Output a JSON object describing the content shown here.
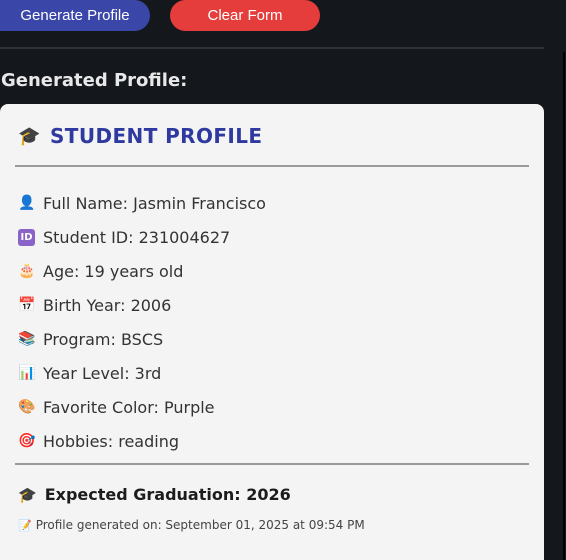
{
  "toolbar": {
    "generate_label": "Generate Profile",
    "clear_label": "Clear Form",
    "generate_color": "#3a46a8",
    "clear_color": "#e53c3c"
  },
  "generated_heading": "Generated Profile:",
  "card": {
    "title_icon": "graduation-cap-icon",
    "title": "STUDENT PROFILE",
    "title_color": "#2f3aa0",
    "fields": [
      {
        "icon": "person-icon",
        "text": "Full Name: Jasmin Francisco"
      },
      {
        "icon": "id-icon",
        "text": "Student ID: 231004627"
      },
      {
        "icon": "birthday-cake-icon",
        "text": "Age: 19 years old"
      },
      {
        "icon": "calendar-icon",
        "text": "Birth Year: 2006"
      },
      {
        "icon": "books-icon",
        "text": "Program: BSCS"
      },
      {
        "icon": "bar-chart-icon",
        "text": "Year Level: 3rd"
      },
      {
        "icon": "palette-icon",
        "text": "Favorite Color: Purple"
      },
      {
        "icon": "target-icon",
        "text": "Hobbies: reading"
      }
    ],
    "graduation_icon": "graduation-cap-icon",
    "graduation": "Expected Graduation: 2026",
    "timestamp_icon": "memo-icon",
    "timestamp": "Profile generated on: September 01, 2025 at 09:54 PM"
  }
}
